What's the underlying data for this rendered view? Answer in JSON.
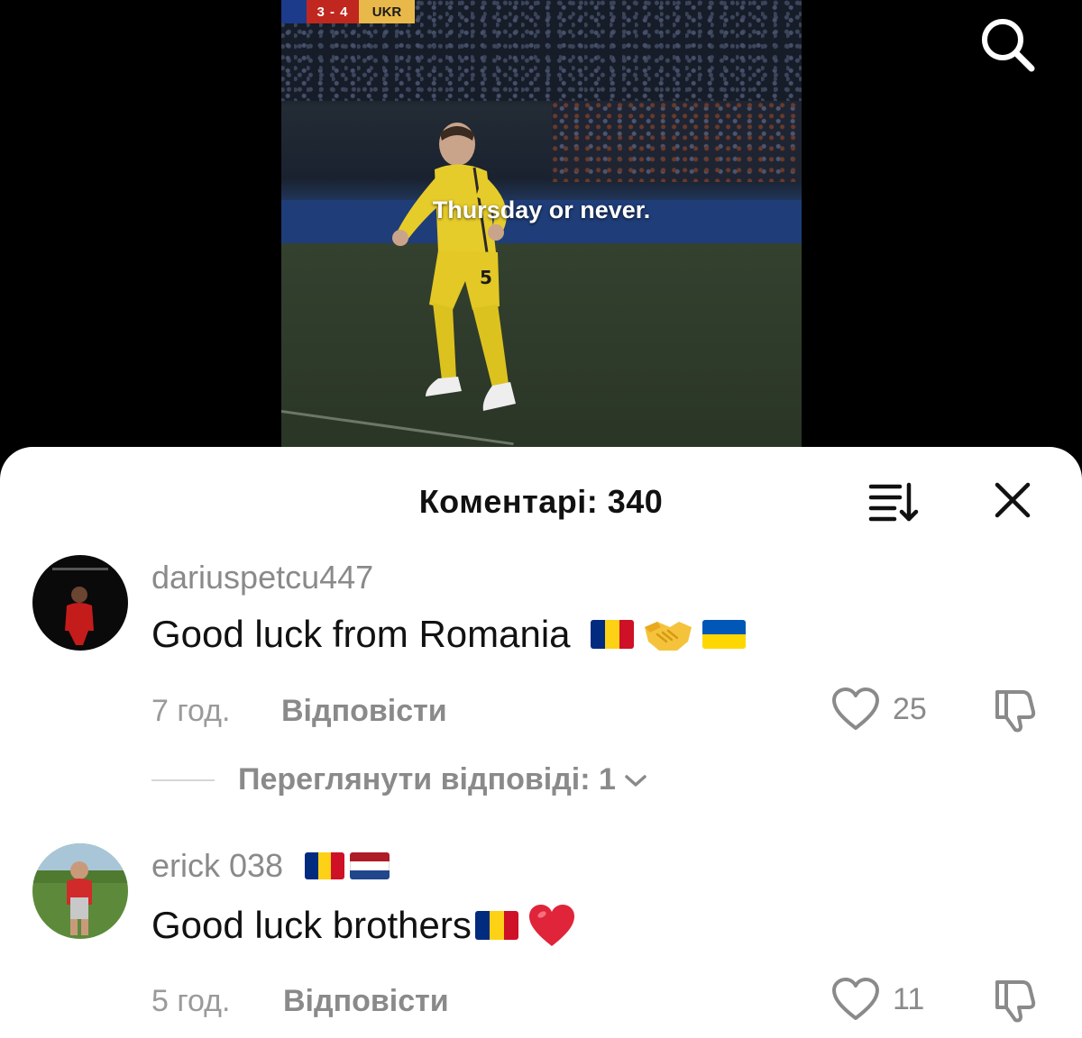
{
  "video": {
    "score": "3 - 4",
    "team": "UKR",
    "caption": "Thursday or never."
  },
  "toolbar": {
    "search_icon": "search-icon"
  },
  "comments_sheet": {
    "title": "Коментарі: 340",
    "sort_icon": "sort-icon",
    "close_icon": "close-icon",
    "comments": [
      {
        "username": "dariuspetcu447",
        "text": "Good luck from Romania",
        "time": "7 год.",
        "reply_label": "Відповісти",
        "likes": "25",
        "view_replies": "Переглянути відповіді: 1"
      },
      {
        "username": "erick 038",
        "text": "Good luck brothers",
        "time": "5 год.",
        "reply_label": "Відповісти",
        "likes": "11"
      }
    ]
  },
  "colors": {
    "romania_flag": [
      "#002b7f",
      "#fcd116",
      "#ce1126"
    ],
    "ukraine_flag": [
      "#0057b7",
      "#ffd700"
    ],
    "netherlands_flag": [
      "#ae1c28",
      "#ffffff",
      "#21468b"
    ],
    "heart": "#e0243a"
  }
}
